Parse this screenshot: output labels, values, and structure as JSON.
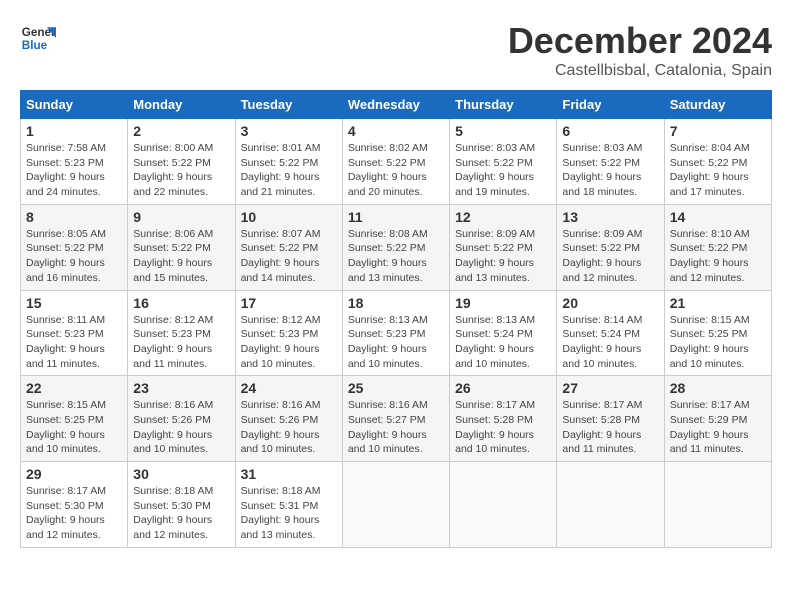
{
  "logo": {
    "line1": "General",
    "line2": "Blue"
  },
  "title": "December 2024",
  "location": "Castellbisbal, Catalonia, Spain",
  "headers": [
    "Sunday",
    "Monday",
    "Tuesday",
    "Wednesday",
    "Thursday",
    "Friday",
    "Saturday"
  ],
  "weeks": [
    [
      {
        "day": "1",
        "info": "Sunrise: 7:58 AM\nSunset: 5:23 PM\nDaylight: 9 hours\nand 24 minutes."
      },
      {
        "day": "2",
        "info": "Sunrise: 8:00 AM\nSunset: 5:22 PM\nDaylight: 9 hours\nand 22 minutes."
      },
      {
        "day": "3",
        "info": "Sunrise: 8:01 AM\nSunset: 5:22 PM\nDaylight: 9 hours\nand 21 minutes."
      },
      {
        "day": "4",
        "info": "Sunrise: 8:02 AM\nSunset: 5:22 PM\nDaylight: 9 hours\nand 20 minutes."
      },
      {
        "day": "5",
        "info": "Sunrise: 8:03 AM\nSunset: 5:22 PM\nDaylight: 9 hours\nand 19 minutes."
      },
      {
        "day": "6",
        "info": "Sunrise: 8:03 AM\nSunset: 5:22 PM\nDaylight: 9 hours\nand 18 minutes."
      },
      {
        "day": "7",
        "info": "Sunrise: 8:04 AM\nSunset: 5:22 PM\nDaylight: 9 hours\nand 17 minutes."
      }
    ],
    [
      {
        "day": "8",
        "info": "Sunrise: 8:05 AM\nSunset: 5:22 PM\nDaylight: 9 hours\nand 16 minutes."
      },
      {
        "day": "9",
        "info": "Sunrise: 8:06 AM\nSunset: 5:22 PM\nDaylight: 9 hours\nand 15 minutes."
      },
      {
        "day": "10",
        "info": "Sunrise: 8:07 AM\nSunset: 5:22 PM\nDaylight: 9 hours\nand 14 minutes."
      },
      {
        "day": "11",
        "info": "Sunrise: 8:08 AM\nSunset: 5:22 PM\nDaylight: 9 hours\nand 13 minutes."
      },
      {
        "day": "12",
        "info": "Sunrise: 8:09 AM\nSunset: 5:22 PM\nDaylight: 9 hours\nand 13 minutes."
      },
      {
        "day": "13",
        "info": "Sunrise: 8:09 AM\nSunset: 5:22 PM\nDaylight: 9 hours\nand 12 minutes."
      },
      {
        "day": "14",
        "info": "Sunrise: 8:10 AM\nSunset: 5:22 PM\nDaylight: 9 hours\nand 12 minutes."
      }
    ],
    [
      {
        "day": "15",
        "info": "Sunrise: 8:11 AM\nSunset: 5:23 PM\nDaylight: 9 hours\nand 11 minutes."
      },
      {
        "day": "16",
        "info": "Sunrise: 8:12 AM\nSunset: 5:23 PM\nDaylight: 9 hours\nand 11 minutes."
      },
      {
        "day": "17",
        "info": "Sunrise: 8:12 AM\nSunset: 5:23 PM\nDaylight: 9 hours\nand 10 minutes."
      },
      {
        "day": "18",
        "info": "Sunrise: 8:13 AM\nSunset: 5:23 PM\nDaylight: 9 hours\nand 10 minutes."
      },
      {
        "day": "19",
        "info": "Sunrise: 8:13 AM\nSunset: 5:24 PM\nDaylight: 9 hours\nand 10 minutes."
      },
      {
        "day": "20",
        "info": "Sunrise: 8:14 AM\nSunset: 5:24 PM\nDaylight: 9 hours\nand 10 minutes."
      },
      {
        "day": "21",
        "info": "Sunrise: 8:15 AM\nSunset: 5:25 PM\nDaylight: 9 hours\nand 10 minutes."
      }
    ],
    [
      {
        "day": "22",
        "info": "Sunrise: 8:15 AM\nSunset: 5:25 PM\nDaylight: 9 hours\nand 10 minutes."
      },
      {
        "day": "23",
        "info": "Sunrise: 8:16 AM\nSunset: 5:26 PM\nDaylight: 9 hours\nand 10 minutes."
      },
      {
        "day": "24",
        "info": "Sunrise: 8:16 AM\nSunset: 5:26 PM\nDaylight: 9 hours\nand 10 minutes."
      },
      {
        "day": "25",
        "info": "Sunrise: 8:16 AM\nSunset: 5:27 PM\nDaylight: 9 hours\nand 10 minutes."
      },
      {
        "day": "26",
        "info": "Sunrise: 8:17 AM\nSunset: 5:28 PM\nDaylight: 9 hours\nand 10 minutes."
      },
      {
        "day": "27",
        "info": "Sunrise: 8:17 AM\nSunset: 5:28 PM\nDaylight: 9 hours\nand 11 minutes."
      },
      {
        "day": "28",
        "info": "Sunrise: 8:17 AM\nSunset: 5:29 PM\nDaylight: 9 hours\nand 11 minutes."
      }
    ],
    [
      {
        "day": "29",
        "info": "Sunrise: 8:17 AM\nSunset: 5:30 PM\nDaylight: 9 hours\nand 12 minutes."
      },
      {
        "day": "30",
        "info": "Sunrise: 8:18 AM\nSunset: 5:30 PM\nDaylight: 9 hours\nand 12 minutes."
      },
      {
        "day": "31",
        "info": "Sunrise: 8:18 AM\nSunset: 5:31 PM\nDaylight: 9 hours\nand 13 minutes."
      },
      {
        "day": "",
        "info": ""
      },
      {
        "day": "",
        "info": ""
      },
      {
        "day": "",
        "info": ""
      },
      {
        "day": "",
        "info": ""
      }
    ]
  ]
}
